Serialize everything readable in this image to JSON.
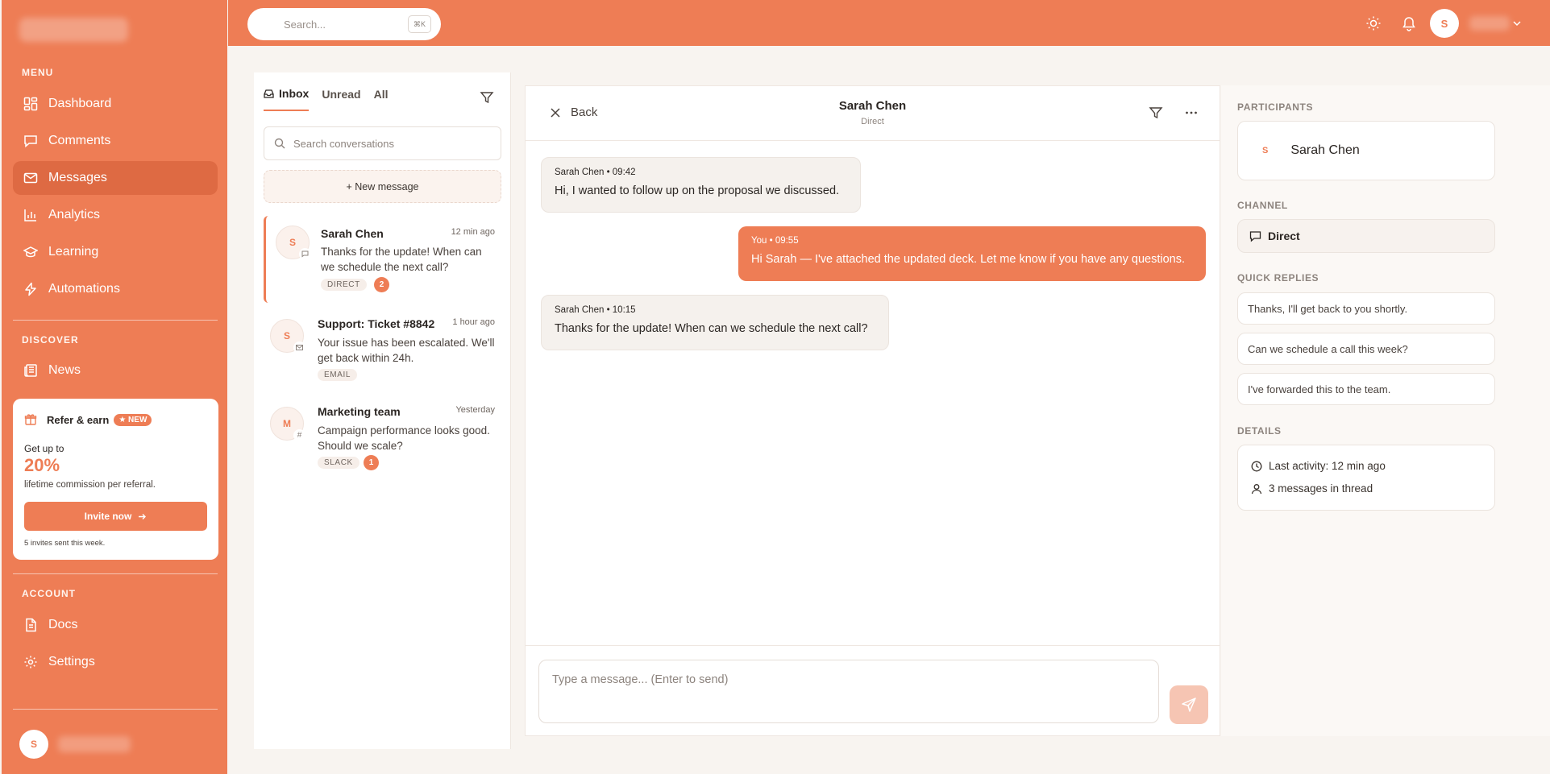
{
  "sidebar": {
    "sections": {
      "menu": "MENU",
      "discover": "DISCOVER",
      "account": "ACCOUNT"
    },
    "menu_items": [
      {
        "label": "Dashboard",
        "icon": "dashboard-icon"
      },
      {
        "label": "Comments",
        "icon": "comment-icon"
      },
      {
        "label": "Messages",
        "icon": "mail-icon",
        "active": true
      },
      {
        "label": "Analytics",
        "icon": "bar-chart-icon"
      },
      {
        "label": "Learning",
        "icon": "graduation-cap-icon"
      },
      {
        "label": "Automations",
        "icon": "lightning-icon"
      }
    ],
    "discover_items": [
      {
        "label": "News",
        "icon": "newspaper-icon"
      }
    ],
    "account_items": [
      {
        "label": "Docs",
        "icon": "document-icon"
      },
      {
        "label": "Settings",
        "icon": "gear-icon"
      }
    ],
    "refer": {
      "title": "Refer & earn",
      "badge": "★ NEW",
      "upto": "Get up to",
      "percent": "20%",
      "desc": "lifetime commission per referral.",
      "button": "Invite now",
      "note": "5 invites sent this week."
    },
    "user_initial": "S"
  },
  "topbar": {
    "search_placeholder": "Search...",
    "shortcut": "⌘K",
    "user_initial": "S"
  },
  "conversations": {
    "tabs": [
      "Inbox",
      "Unread",
      "All"
    ],
    "search_placeholder": "Search conversations",
    "new_message": "+ New message",
    "items": [
      {
        "initial": "S",
        "name": "Sarah Chen",
        "time": "12 min ago",
        "preview": "Thanks for the update! When can we schedule the next call?",
        "tag": "DIRECT",
        "count": "2"
      },
      {
        "initial": "S",
        "name": "Support: Ticket #8842",
        "time": "1 hour ago",
        "preview": "Your issue has been escalated. We'll get back within 24h.",
        "tag": "EMAIL",
        "count": ""
      },
      {
        "initial": "M",
        "name": "Marketing team",
        "time": "Yesterday",
        "preview": "Campaign performance looks good. Should we scale?",
        "tag": "SLACK",
        "count": "1"
      }
    ]
  },
  "chat": {
    "back": "Back",
    "title": "Sarah Chen",
    "subtitle": "Direct",
    "messages": [
      {
        "meta": "Sarah Chen • 09:42",
        "text": "Hi, I wanted to follow up on the proposal we discussed."
      },
      {
        "meta": "You • 09:55",
        "text": "Hi Sarah — I've attached the updated deck. Let me know if you have any questions."
      },
      {
        "meta": "Sarah Chen • 10:15",
        "text": "Thanks for the update! When can we schedule the next call?"
      }
    ],
    "composer_placeholder": "Type a message... (Enter to send)"
  },
  "panel": {
    "participants_label": "PARTICIPANTS",
    "participant": {
      "initial": "S",
      "name": "Sarah Chen"
    },
    "channel_label": "CHANNEL",
    "channel": "Direct",
    "quick_replies_label": "QUICK REPLIES",
    "quick_replies": [
      "Thanks, I'll get back to you shortly.",
      "Can we schedule a call this week?",
      "I've forwarded this to the team."
    ],
    "details_label": "DETAILS",
    "details": [
      "Last activity: 12 min ago",
      "3 messages in thread"
    ]
  },
  "colors": {
    "accent": "#ee7d55",
    "accent_active": "#de6a43",
    "background": "#f8f4f0"
  }
}
